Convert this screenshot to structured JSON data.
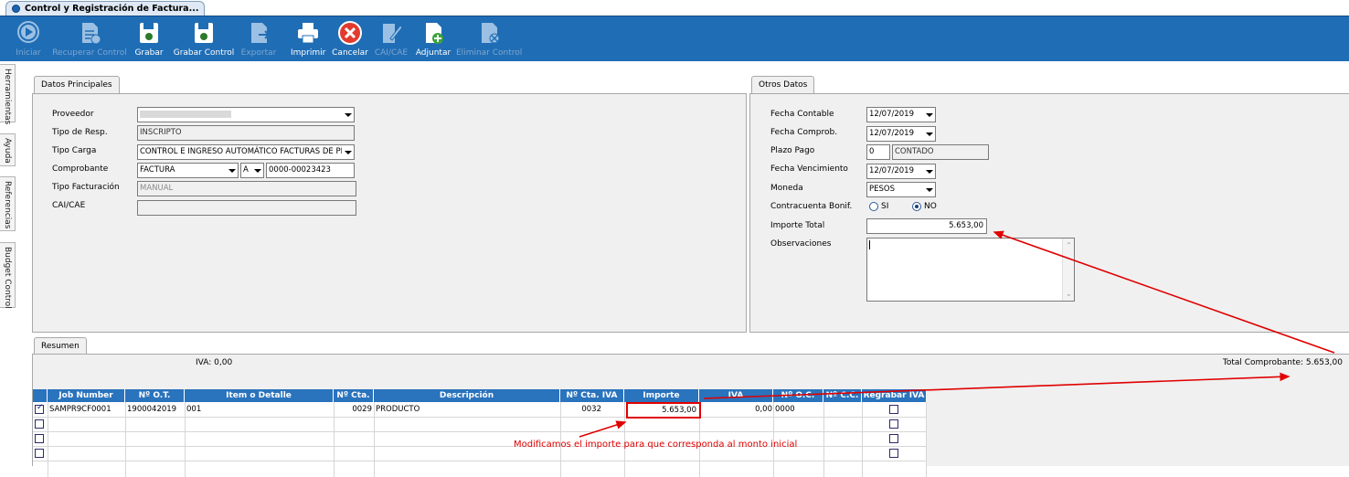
{
  "window": {
    "tab_title": "Control y Registración de Factura..."
  },
  "toolbar": {
    "buttons": [
      {
        "label": "Iniciar",
        "icon": "play-icon",
        "enabled": false
      },
      {
        "label": "Recuperar Control",
        "icon": "recover-icon",
        "enabled": false
      },
      {
        "label": "Grabar",
        "icon": "save-icon",
        "enabled": true
      },
      {
        "label": "Grabar Control",
        "icon": "save-control-icon",
        "enabled": true
      },
      {
        "label": "Exportar",
        "icon": "export-icon",
        "enabled": false
      },
      {
        "label": "Imprimir",
        "icon": "printer-icon",
        "enabled": true
      },
      {
        "label": "Cancelar",
        "icon": "cancel-icon",
        "enabled": true
      },
      {
        "label": "CAI/CAE",
        "icon": "cai-icon",
        "enabled": false
      },
      {
        "label": "Adjuntar",
        "icon": "attach-icon",
        "enabled": true
      },
      {
        "label": "Eliminar Control",
        "icon": "delete-control-icon",
        "enabled": false
      }
    ]
  },
  "side_tabs": [
    "Herramientas",
    "Ayuda",
    "Referencias",
    "Budget Control"
  ],
  "datos_principales": {
    "tab": "Datos Principales",
    "proveedor_label": "Proveedor",
    "proveedor_value": "",
    "tipo_resp_label": "Tipo de Resp.",
    "tipo_resp_value": "INSCRIPTO",
    "tipo_carga_label": "Tipo Carga",
    "tipo_carga_value": "CONTROL E INGRESO AUTOMÁTICO FACTURAS DE PRO",
    "comprobante_label": "Comprobante",
    "comprobante_tipo": "FACTURA",
    "comprobante_letra": "A",
    "comprobante_numero": "0000-00023423",
    "tipo_facturacion_label": "Tipo Facturación",
    "tipo_facturacion_value": "MANUAL",
    "cai_label": "CAI/CAE",
    "cai_value": ""
  },
  "otros_datos": {
    "tab": "Otros Datos",
    "fecha_contable_label": "Fecha Contable",
    "fecha_contable": "12/07/2019",
    "fecha_comprob_label": "Fecha Comprob.",
    "fecha_comprob": "12/07/2019",
    "plazo_pago_label": "Plazo Pago",
    "plazo_pago_dias": "0",
    "plazo_pago_desc": "CONTADO",
    "fecha_venc_label": "Fecha Vencimiento",
    "fecha_venc": "12/07/2019",
    "moneda_label": "Moneda",
    "moneda": "PESOS",
    "contracuenta_label": "Contracuenta Bonif.",
    "opt_si": "SI",
    "opt_no": "NO",
    "selected": "NO",
    "importe_total_label": "Importe Total",
    "importe_total": "5.653,00",
    "observaciones_label": "Observaciones",
    "observaciones": ""
  },
  "resumen": {
    "tab": "Resumen",
    "iva_text": "IVA: 0,00",
    "total_text": "Total Comprobante: 5.653,00"
  },
  "grid": {
    "columns": [
      "Job Number",
      "Nº O.T.",
      "Item o Detalle",
      "Nº Cta.",
      "Descripción",
      "Nº Cta. IVA",
      "Importe",
      "IVA",
      "Nº O.C.",
      "Nº C.C.",
      "Regrabar IVA"
    ],
    "rows": [
      {
        "checked": true,
        "job": "SAMPR9CF0001",
        "ot": "1900042019",
        "item": "001",
        "cta": "0029",
        "desc": "PRODUCTO",
        "cta_iva": "0032",
        "importe": "5.653,00",
        "iva": "0,00",
        "oc": "0000",
        "cc": "",
        "regrabar": false
      },
      {
        "checked": false,
        "job": "",
        "ot": "",
        "item": "",
        "cta": "",
        "desc": "",
        "cta_iva": "",
        "importe": "",
        "iva": "",
        "oc": "",
        "cc": "",
        "regrabar": false
      },
      {
        "checked": false,
        "job": "",
        "ot": "",
        "item": "",
        "cta": "",
        "desc": "",
        "cta_iva": "",
        "importe": "",
        "iva": "",
        "oc": "",
        "cc": "",
        "regrabar": false
      },
      {
        "checked": false,
        "job": "",
        "ot": "",
        "item": "",
        "cta": "",
        "desc": "",
        "cta_iva": "",
        "importe": "",
        "iva": "",
        "oc": "",
        "cc": "",
        "regrabar": false
      }
    ]
  },
  "annotation": {
    "text": "Modificamos el importe para que corresponda al monto inicial",
    "color": "#e00000"
  },
  "colors": {
    "toolbar": "#1f6db5",
    "grid_header": "#2a73bd",
    "annotation": "#e00000"
  }
}
